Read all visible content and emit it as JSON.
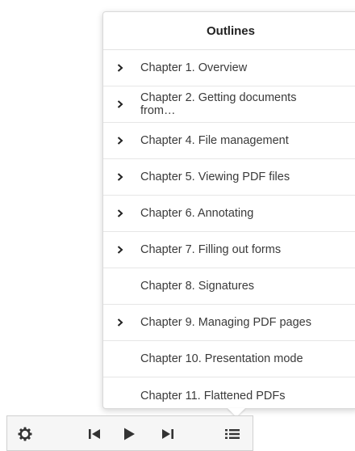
{
  "popover": {
    "title": "Outlines",
    "items": [
      {
        "label": "Chapter 1. Overview",
        "expandable": true
      },
      {
        "label": "Chapter 2. Getting documents from…",
        "expandable": true
      },
      {
        "label": "Chapter 4. File management",
        "expandable": true
      },
      {
        "label": "Chapter 5. Viewing PDF files",
        "expandable": true
      },
      {
        "label": "Chapter 6. Annotating",
        "expandable": true
      },
      {
        "label": "Chapter 7. Filling out forms",
        "expandable": true
      },
      {
        "label": "Chapter 8. Signatures",
        "expandable": false
      },
      {
        "label": "Chapter 9. Managing PDF pages",
        "expandable": true
      },
      {
        "label": "Chapter 10. Presentation mode",
        "expandable": false
      },
      {
        "label": "Chapter 11. Flattened PDFs",
        "expandable": false
      }
    ]
  },
  "toolbar": {
    "buttons": [
      {
        "name": "settings",
        "icon": "gear-icon"
      },
      {
        "name": "previous",
        "icon": "skip-previous-icon"
      },
      {
        "name": "play",
        "icon": "play-icon"
      },
      {
        "name": "next",
        "icon": "skip-next-icon"
      },
      {
        "name": "outline",
        "icon": "list-icon"
      }
    ]
  },
  "colors": {
    "text": "#3a3a3a",
    "icon": "#333333",
    "separator": "#e6e6e6",
    "toolbar_bg": "#f6f6f6"
  }
}
